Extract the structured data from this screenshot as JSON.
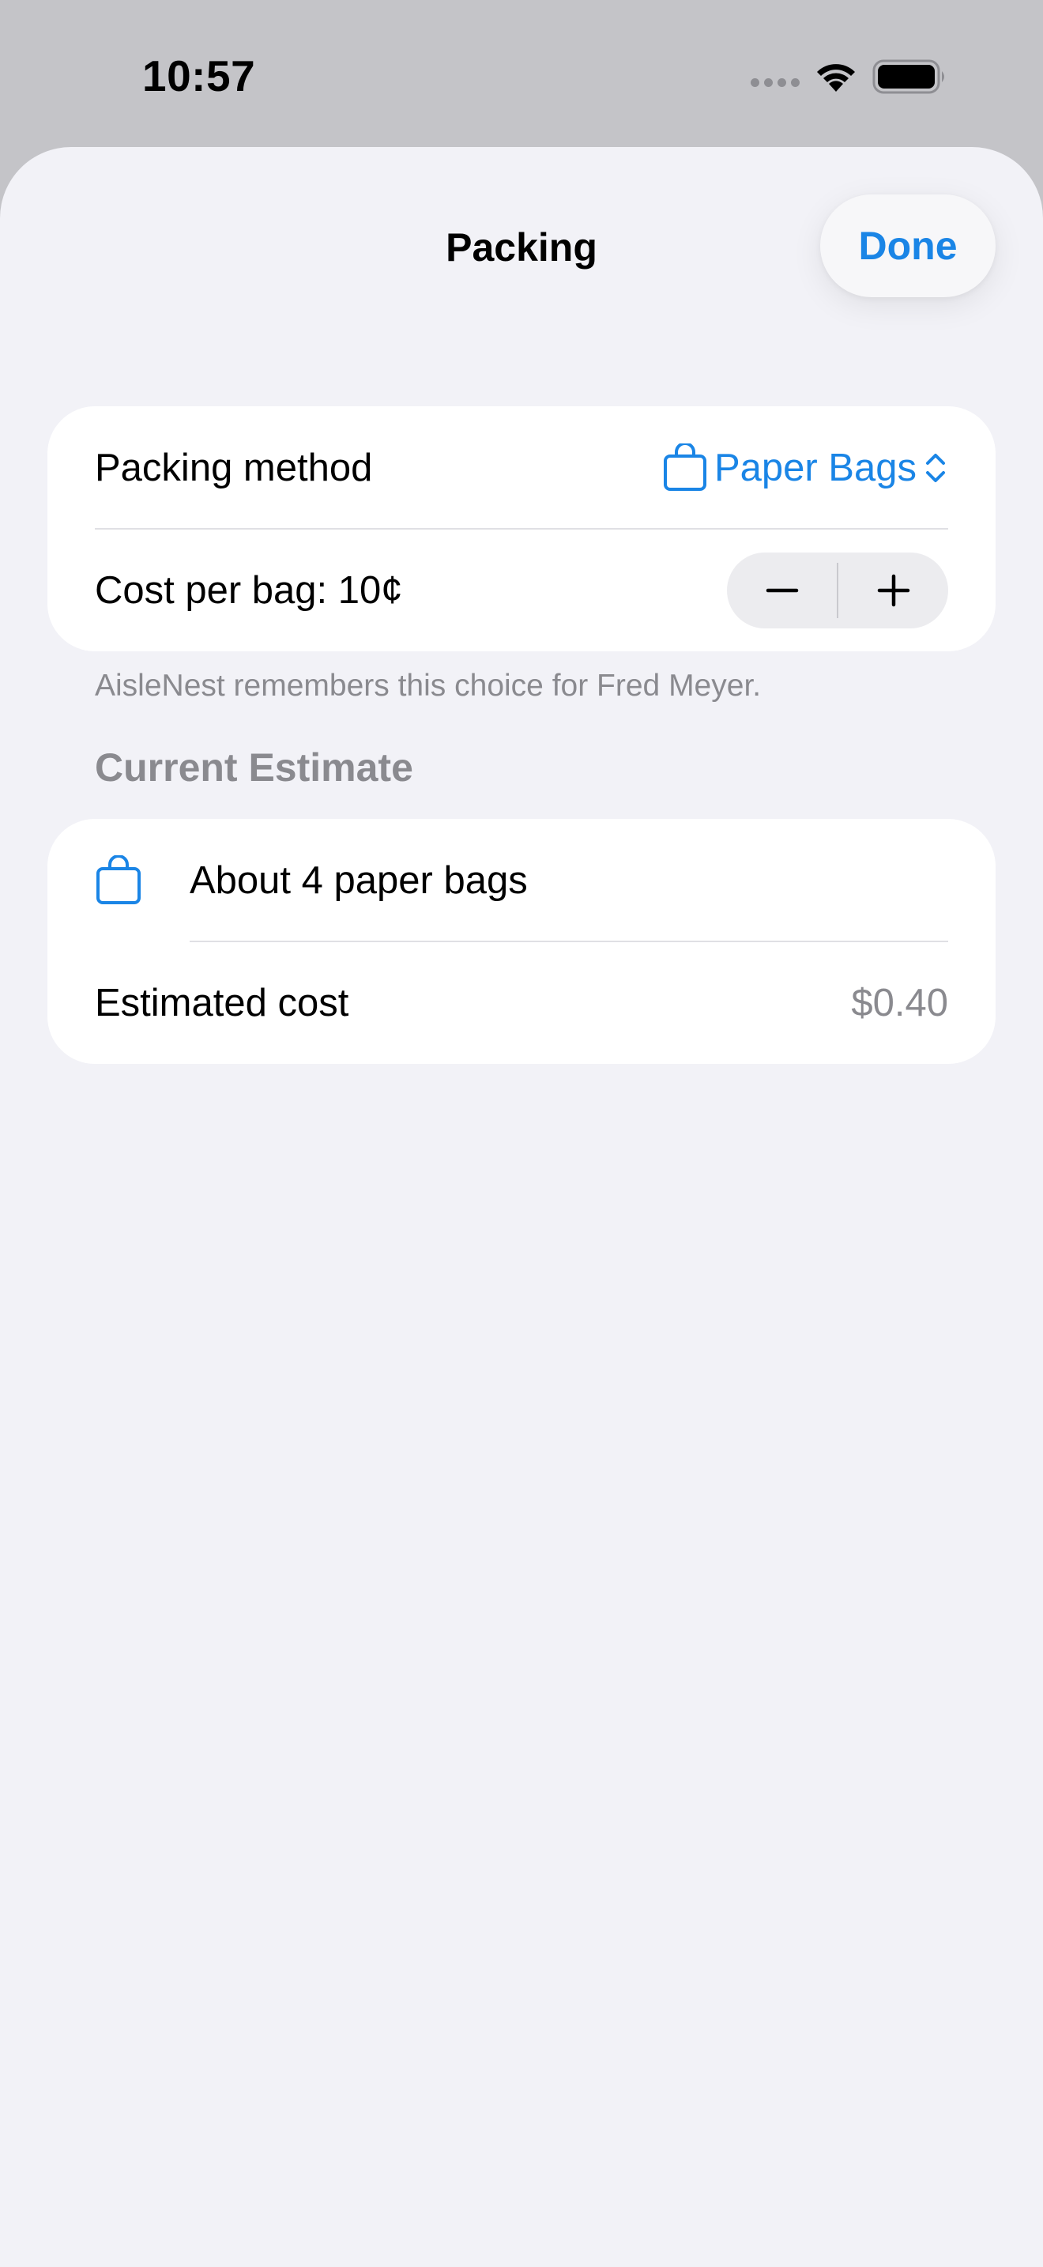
{
  "status_bar": {
    "time": "10:57",
    "icons": [
      "cellular-signal-icon",
      "wifi-icon",
      "battery-icon"
    ]
  },
  "sheet": {
    "title": "Packing",
    "done_label": "Done"
  },
  "packing_card": {
    "method_label": "Packing method",
    "method_value": "Paper Bags",
    "cost_label": "Cost per bag: 10¢"
  },
  "footnote": "AisleNest remembers this choice for Fred Meyer.",
  "estimate": {
    "header": "Current Estimate",
    "bag_count_label": "About 4 paper bags",
    "cost_label": "Estimated cost",
    "cost_value": "$0.40"
  },
  "colors": {
    "accent": "#1a85e6",
    "background": "#f2f2f7",
    "secondary_text": "#8a8a8f"
  }
}
